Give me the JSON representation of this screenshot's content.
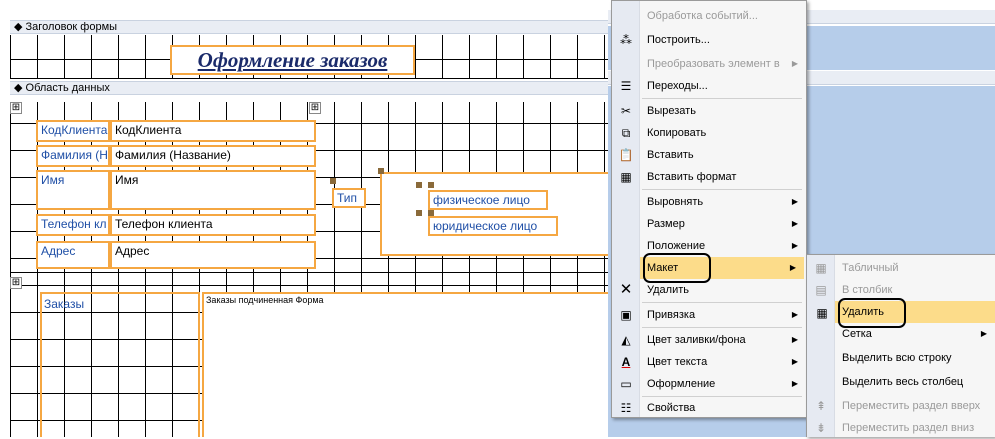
{
  "form": {
    "header_section": "Заголовок формы",
    "title": "Оформление заказов",
    "detail_section": "Область данных",
    "fields": [
      {
        "label": "КодКлиента",
        "value": "КодКлиента"
      },
      {
        "label": "Фамилия (Н",
        "value": "Фамилия (Название)"
      },
      {
        "label": "Имя",
        "value": "Имя"
      },
      {
        "label": "Телефон кл",
        "value": "Телефон клиента"
      },
      {
        "label": "Адрес",
        "value": "Адрес"
      }
    ],
    "type_label": "Тип",
    "options": [
      "физическое лицо",
      "юридическое лицо"
    ],
    "subform_label": "Заказы",
    "subform_name": "Заказы подчиненная Форма"
  },
  "context_menu": {
    "items": [
      {
        "label": "Обработка событий...",
        "disabled": true
      },
      {
        "label": "Построить...",
        "icon": "build-icon"
      },
      {
        "label": "Преобразовать элемент в",
        "disabled": true,
        "submenu": true
      },
      {
        "label": "Переходы...",
        "icon": "tab-order-icon"
      },
      {
        "label": "Вырезать",
        "icon": "scissors-icon"
      },
      {
        "label": "Копировать",
        "icon": "copy-icon"
      },
      {
        "label": "Вставить",
        "icon": "paste-icon"
      },
      {
        "label": "Вставить формат",
        "icon": "paste-format-icon"
      },
      {
        "label": "Выровнять",
        "submenu": true
      },
      {
        "label": "Размер",
        "submenu": true
      },
      {
        "label": "Положение",
        "submenu": true
      },
      {
        "label": "Макет",
        "submenu": true,
        "highlighted": true
      },
      {
        "label": "Удалить",
        "icon": "delete-x-icon"
      },
      {
        "label": "Привязка",
        "icon": "anchor-icon",
        "submenu": true
      },
      {
        "label": "Цвет заливки/фона",
        "icon": "fill-color-icon",
        "submenu": true
      },
      {
        "label": "Цвет текста",
        "icon": "font-color-icon",
        "submenu": true
      },
      {
        "label": "Оформление",
        "icon": "effect-icon",
        "submenu": true
      },
      {
        "label": "Свойства",
        "icon": "properties-icon"
      }
    ]
  },
  "submenu": {
    "items": [
      {
        "label": "Табличный",
        "disabled": true
      },
      {
        "label": "В столбик",
        "disabled": true
      },
      {
        "label": "Удалить",
        "highlighted": true
      },
      {
        "label": "Сетка",
        "submenu": true
      },
      {
        "label": "Выделить всю строку"
      },
      {
        "label": "Выделить весь столбец"
      },
      {
        "label": "Переместить раздел вверх",
        "disabled": true
      },
      {
        "label": "Переместить раздел вниз",
        "disabled": true
      }
    ]
  },
  "colors": {
    "control_border": "#f5a742",
    "highlight": "#fcdc8a",
    "panel_blue": "#b6cdea",
    "label_blue": "#1f4fa6"
  }
}
